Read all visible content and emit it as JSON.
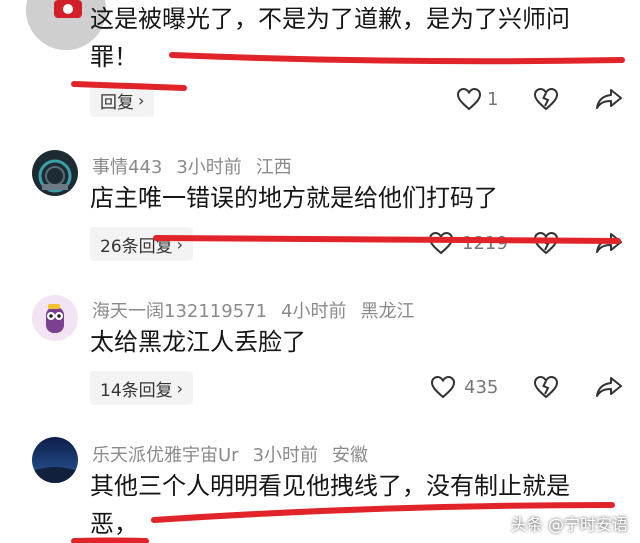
{
  "comments": [
    {
      "content_line1": "这是被曝光了，不是为了道歉，是为了兴师问",
      "content_line2": "罪！",
      "reply_label": "回复",
      "likes": "1"
    },
    {
      "username": "事情443",
      "time": "3小时前",
      "location": "江西",
      "content_line1": "店主唯一错误的地方就是给他们打码了",
      "reply_label": "26条回复",
      "likes": "1219"
    },
    {
      "username": "海天一阔132119571",
      "time": "4小时前",
      "location": "黑龙江",
      "content_line1": "太给黑龙江人丢脸了",
      "reply_label": "14条回复",
      "likes": "435"
    },
    {
      "username": "乐天派优雅宇宙Ur",
      "time": "3小时前",
      "location": "安徽",
      "content_line1": "其他三个人明明看见他拽线了，没有制止就是",
      "content_line2": "恶，"
    }
  ],
  "watermark": "头条 @宁时安语",
  "colors": {
    "annotation_red": "#e0242a",
    "meta_gray": "#8a8a8a"
  }
}
